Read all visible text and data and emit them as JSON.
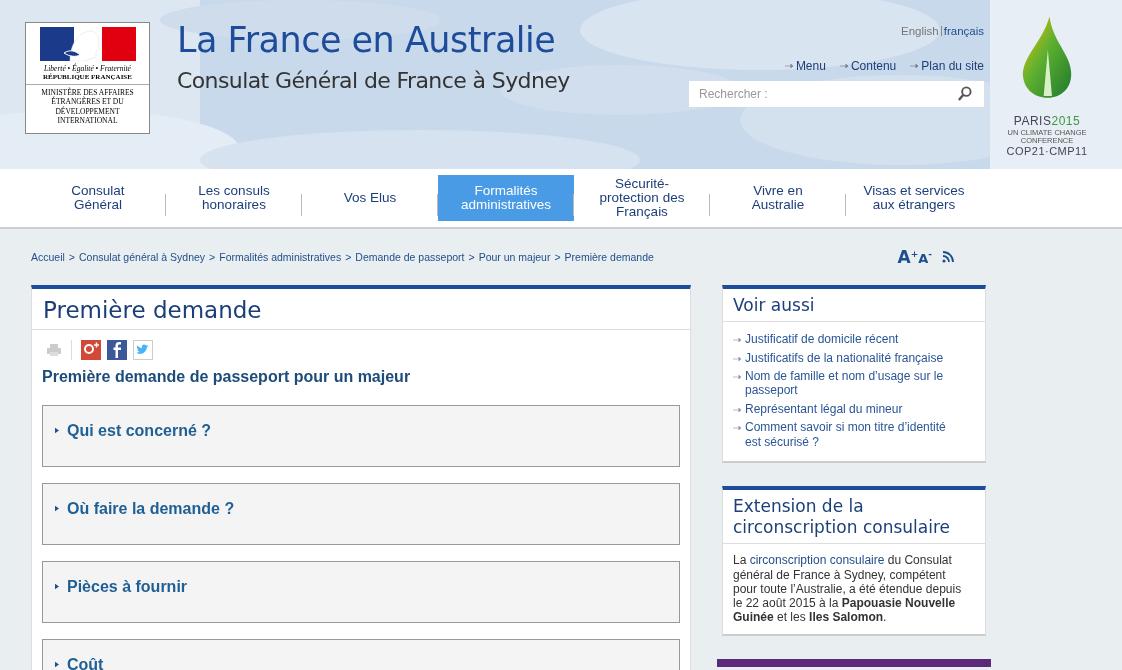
{
  "header": {
    "logo": {
      "motto": "Liberté • Égalité • Fraternité",
      "republic": "RÉPUBLIQUE FRANÇAISE",
      "ministry": "MINISTÈRE DES AFFAIRES ÉTRANGÈRES ET DU DÉVELOPPEMENT INTERNATIONAL"
    },
    "title": "La France en Australie",
    "subtitle": "Consulat Général de France à Sydney",
    "languages": [
      {
        "label": "English",
        "selected": false
      },
      {
        "label": "français",
        "selected": true
      }
    ],
    "quick_links": [
      "Menu",
      "Contenu",
      "Plan du site"
    ],
    "search": {
      "placeholder": "Rechercher :"
    },
    "cop_logo": {
      "line_1a": "PARIS",
      "line_1b": "2015",
      "line_2": "UN CLIMATE CHANGE CONFERENCE",
      "line_3": "COP21·CMP11"
    }
  },
  "nav": [
    {
      "label": "Consulat Général",
      "selected": false
    },
    {
      "label": "Les consuls honoraires",
      "selected": false
    },
    {
      "label": "Vos Elus",
      "selected": false
    },
    {
      "label": "Formalités administratives",
      "selected": true
    },
    {
      "label": "Sécurité-protection des Français",
      "selected": false
    },
    {
      "label": "Vivre en Australie",
      "selected": false
    },
    {
      "label": "Visas et services aux étrangers",
      "selected": false
    }
  ],
  "breadcrumb_separator": ">",
  "breadcrumb": [
    "Accueil",
    "Consulat général à Sydney",
    "Formalités administratives",
    "Demande de passeport",
    "Pour un majeur",
    "Première demande"
  ],
  "text_size": {
    "large": "A",
    "plus": "+",
    "small": "A",
    "minus": "-"
  },
  "article": {
    "title": "Première demande",
    "subtitle": "Première demande de passeport pour un majeur",
    "sections": [
      {
        "label": "Qui est concerné ?",
        "expanded": false
      },
      {
        "label": "Où faire la demande ?",
        "expanded": false
      },
      {
        "label": "Pièces à fournir",
        "expanded": false
      },
      {
        "label": "Coût",
        "expanded": false
      }
    ]
  },
  "see_also": {
    "title": "Voir aussi",
    "links": [
      "Justificatif de domicile récent",
      "Justificatifs de la nationalité française",
      "Nom de famille et nom d’usage sur le passeport",
      "Représentant légal du mineur",
      "Comment savoir si mon titre d’identité est sécurisé ?"
    ]
  },
  "extension": {
    "title": "Extension de la circonscription consulaire",
    "text_before": "La",
    "link": "circonscription consulaire",
    "text_after": "du Consulat général de France à Sydney, compétent pour toute l’Australie, a été étendue depuis le 22 août 2015 à la **Papouasie Nouvelle Guinée** et les **Iles Salomon**."
  }
}
